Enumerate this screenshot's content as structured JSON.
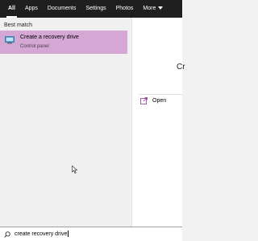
{
  "tabs": [
    {
      "label": "All",
      "active": true
    },
    {
      "label": "Apps"
    },
    {
      "label": "Documents"
    },
    {
      "label": "Settings"
    },
    {
      "label": "Photos"
    },
    {
      "label": "More"
    }
  ],
  "results": {
    "section_label": "Best match",
    "best_match": {
      "title": "Create a recovery drive",
      "subtitle": "Control panel",
      "icon": "recovery-drive-icon"
    }
  },
  "preview": {
    "title_partial": "Cr",
    "actions": [
      {
        "label": "Open",
        "icon": "open-icon"
      }
    ]
  },
  "search": {
    "value": "create recovery drive",
    "icon": "search-icon"
  },
  "colors": {
    "tabbar_bg": "#1f1f1f",
    "selected_bg": "#d4a7d4",
    "accent": "#8b3a8b"
  }
}
